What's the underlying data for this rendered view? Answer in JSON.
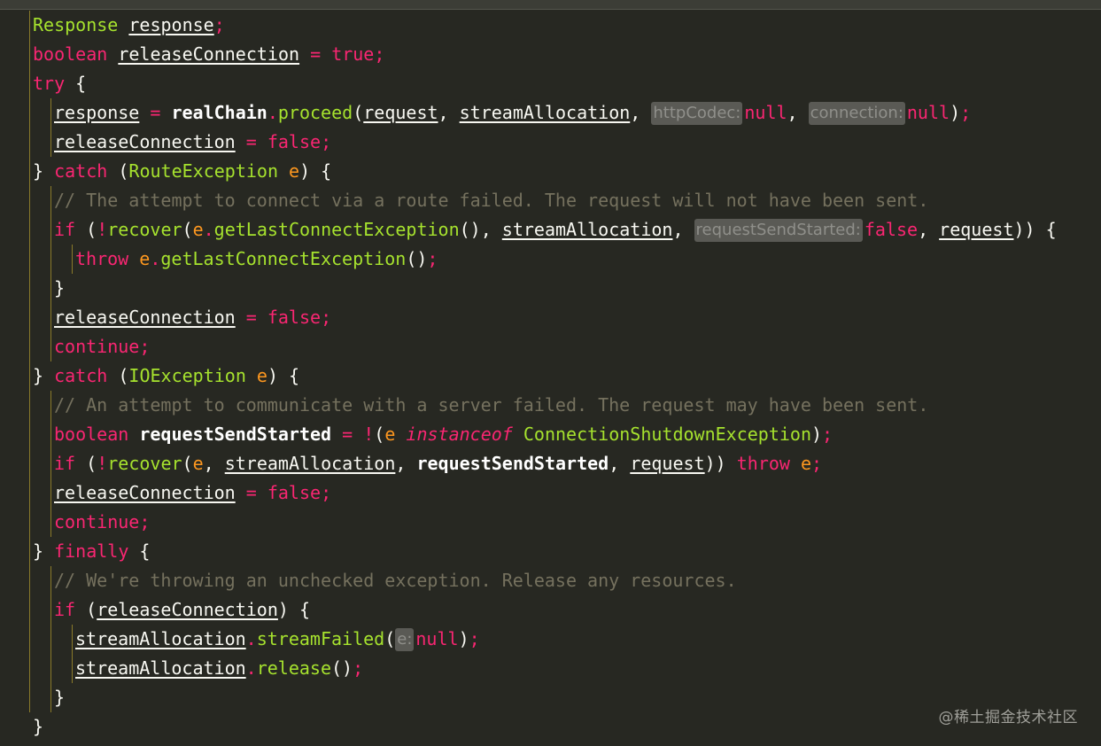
{
  "code": {
    "language": "java",
    "lines": [
      {
        "text": "Response response;"
      },
      {
        "text": "boolean releaseConnection = true;"
      },
      {
        "text": "try {"
      },
      {
        "text": "response = realChain.proceed(request, streamAllocation, null, null);"
      },
      {
        "text": "releaseConnection = false;"
      },
      {
        "text": "} catch (RouteException e) {"
      },
      {
        "text": "// The attempt to connect via a route failed. The request will not have been sent."
      },
      {
        "text": "if (!recover(e.getLastConnectException(), streamAllocation, false, request)) {"
      },
      {
        "text": "throw e.getLastConnectException();"
      },
      {
        "text": "}"
      },
      {
        "text": "releaseConnection = false;"
      },
      {
        "text": "continue;"
      },
      {
        "text": "} catch (IOException e) {"
      },
      {
        "text": "// An attempt to communicate with a server failed. The request may have been sent."
      },
      {
        "text": "boolean requestSendStarted = !(e instanceof ConnectionShutdownException);"
      },
      {
        "text": "if (!recover(e, streamAllocation, requestSendStarted, request)) throw e;"
      },
      {
        "text": "releaseConnection = false;"
      },
      {
        "text": "continue;"
      },
      {
        "text": "} finally {"
      },
      {
        "text": "// We're throwing an unchecked exception. Release any resources."
      },
      {
        "text": "if (releaseConnection) {"
      },
      {
        "text": "streamAllocation.streamFailed(null);"
      },
      {
        "text": "streamAllocation.release();"
      },
      {
        "text": "}"
      },
      {
        "text": "}"
      }
    ],
    "param_hints": {
      "httpCodec": "httpCodec:",
      "connection": "connection:",
      "requestSendStarted": "requestSendStarted:",
      "e": "e:"
    }
  },
  "colors": {
    "background": "#272822",
    "keyword": "#f92672",
    "type": "#a6e22e",
    "param": "#fd971f",
    "comment": "#75715e",
    "text": "#f8f8f2",
    "indent_guide": "#8a7a2a"
  },
  "watermark": "@稀土掘金技术社区"
}
